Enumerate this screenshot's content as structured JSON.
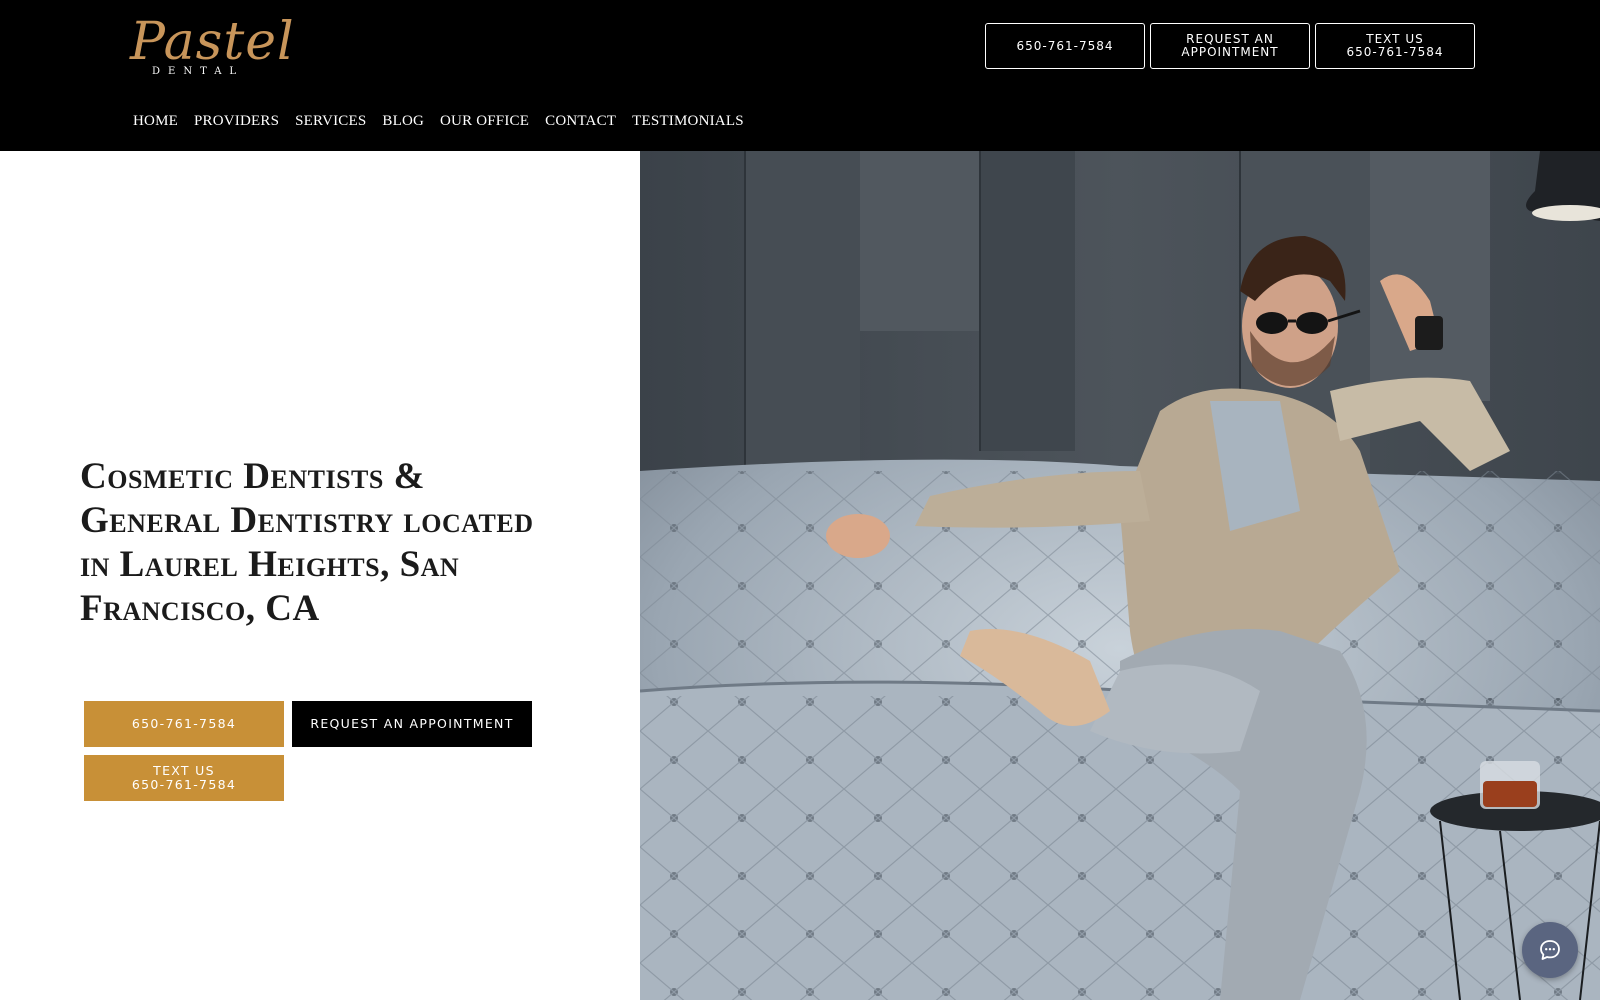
{
  "header": {
    "logo": {
      "script": "Pastel",
      "sub": "DENTAL"
    },
    "buttons": {
      "phone": "650-761-7584",
      "appointment_line1": "REQUEST AN",
      "appointment_line2": "APPOINTMENT",
      "text_line1": "TEXT US",
      "text_line2": "650-761-7584"
    },
    "nav": [
      "HOME",
      "PROVIDERS",
      "SERVICES",
      "BLOG",
      "OUR OFFICE",
      "CONTACT",
      "TESTIMONIALS"
    ]
  },
  "hero": {
    "title": "Cosmetic Dentists & General Dentistry located in Laurel Heights, San Francisco, CA",
    "cta": {
      "phone": "650-761-7584",
      "appointment": "REQUEST AN APPOINTMENT",
      "text_line1": "TEXT US",
      "text_line2": "650-761-7584"
    }
  },
  "colors": {
    "header_bg": "#000000",
    "gold": "#c89037",
    "logo_gold": "#c8955a",
    "chat_button": "#5a6580"
  },
  "icons": {
    "chat": "chat-bubble-icon"
  }
}
